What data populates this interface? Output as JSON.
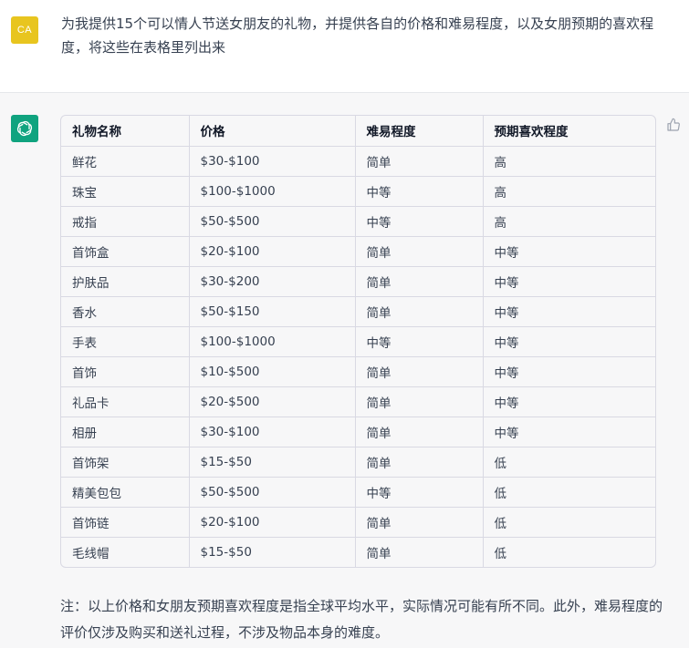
{
  "user": {
    "avatar_initials": "CA",
    "avatar_color": "#e8c51f",
    "message": "为我提供15个可以情人节送女朋友的礼物，并提供各自的价格和难易程度，以及女朋预期的喜欢程度，将这些在表格里列出来"
  },
  "assistant": {
    "avatar_icon": "openai-logo-icon",
    "avatar_color": "#10a37f",
    "feedback_icon": "thumbs-up-icon",
    "table": {
      "headers": [
        "礼物名称",
        "价格",
        "难易程度",
        "预期喜欢程度"
      ],
      "rows": [
        [
          "鲜花",
          "$30-$100",
          "简单",
          "高"
        ],
        [
          "珠宝",
          "$100-$1000",
          "中等",
          "高"
        ],
        [
          "戒指",
          "$50-$500",
          "中等",
          "高"
        ],
        [
          "首饰盒",
          "$20-$100",
          "简单",
          "中等"
        ],
        [
          "护肤品",
          "$30-$200",
          "简单",
          "中等"
        ],
        [
          "香水",
          "$50-$150",
          "简单",
          "中等"
        ],
        [
          "手表",
          "$100-$1000",
          "中等",
          "中等"
        ],
        [
          "首饰",
          "$10-$500",
          "简单",
          "中等"
        ],
        [
          "礼品卡",
          "$20-$500",
          "简单",
          "中等"
        ],
        [
          "相册",
          "$30-$100",
          "简单",
          "中等"
        ],
        [
          "首饰架",
          "$15-$50",
          "简单",
          "低"
        ],
        [
          "精美包包",
          "$50-$500",
          "中等",
          "低"
        ],
        [
          "首饰链",
          "$20-$100",
          "简单",
          "低"
        ],
        [
          "毛线帽",
          "$15-$50",
          "简单",
          "低"
        ]
      ]
    },
    "note": "注：以上价格和女朋友预期喜欢程度是指全球平均水平，实际情况可能有所不同。此外，难易程度的评价仅涉及购买和送礼过程，不涉及物品本身的难度。"
  }
}
